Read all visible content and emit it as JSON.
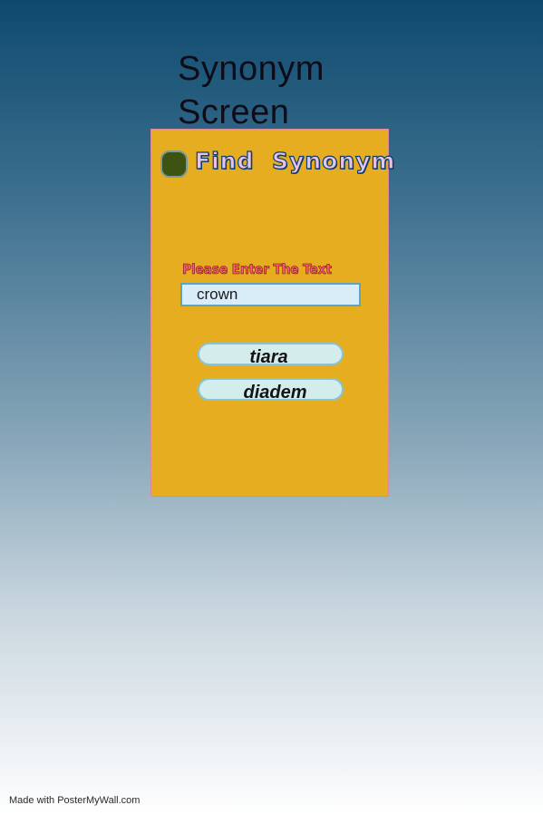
{
  "screen": {
    "title_line1": "Synonym",
    "title_line2": "Screen"
  },
  "card": {
    "title": "Find Synonym",
    "prompt_label": "Please Enter The Text",
    "input_value": "crown",
    "results": [
      "tiara",
      "diadem"
    ]
  },
  "footer": {
    "watermark": "Made with PosterMyWall.com"
  },
  "colors": {
    "card_background": "#e6ad20",
    "status_dot": "#3f5310",
    "result_button": "#d3ecec"
  }
}
